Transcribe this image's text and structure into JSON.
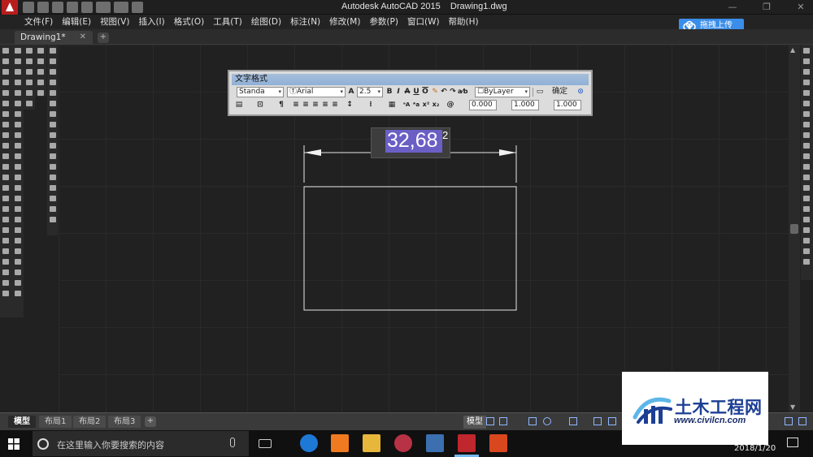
{
  "window": {
    "title": "Autodesk AutoCAD 2015    Drawing1.dwg",
    "app_logo": "autocad-a-logo",
    "controls": [
      "minimize-icon",
      "restore-icon",
      "close-icon"
    ]
  },
  "menu": {
    "items": [
      "文件(F)",
      "编辑(E)",
      "视图(V)",
      "插入(I)",
      "格式(O)",
      "工具(T)",
      "绘图(D)",
      "标注(N)",
      "修改(M)",
      "参数(P)",
      "窗口(W)",
      "帮助(H)"
    ],
    "upload_label": "拖拽上传",
    "close_glyph": "✕"
  },
  "tabs": {
    "doc_tab": "Drawing1*",
    "close_glyph": "✕",
    "new_tab": "+"
  },
  "text_format": {
    "title": "文字格式",
    "style": "Standa",
    "font": "Arial",
    "height": "2.5",
    "bold": "B",
    "italic": "I",
    "strike": "A",
    "underline": "U",
    "overline": "O",
    "color": "ByLayer",
    "ok": "确定",
    "oblique": "0.000",
    "tracking": "1.000",
    "width": "1.000"
  },
  "mtext": {
    "value": "32,68",
    "superscript": "2"
  },
  "layout_tabs": [
    "模型",
    "布局1",
    "布局2",
    "布局3"
  ],
  "layout_add": "+",
  "status": {
    "model": "模型",
    "accent": "#8fb6ff"
  },
  "taskbar": {
    "search_placeholder": "在这里输入你要搜索的内容",
    "date": "2018/1/20"
  },
  "watermark": {
    "title": "土木工程网",
    "url": "www.civilcn.com",
    "brand_color": "#1c3f94"
  }
}
